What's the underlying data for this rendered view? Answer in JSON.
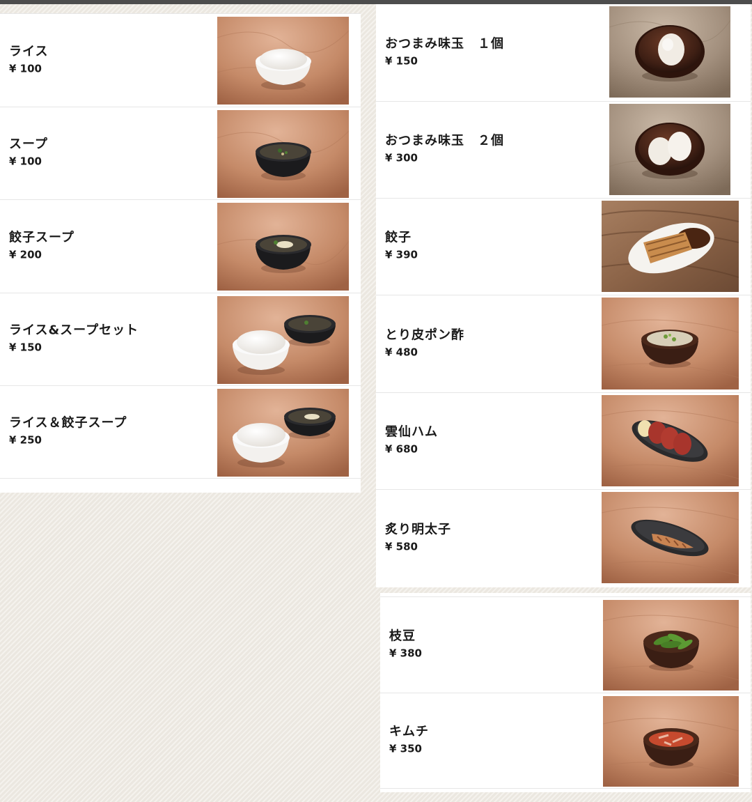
{
  "left_panel": {
    "items": [
      {
        "name": "ライス",
        "price": "¥ 100"
      },
      {
        "name": "スープ",
        "price": "¥ 100"
      },
      {
        "name": "餃子スープ",
        "price": "¥ 200"
      },
      {
        "name": "ライス&スープセット",
        "price": "¥ 150"
      },
      {
        "name": "ライス＆餃子スープ",
        "price": "¥ 250"
      }
    ]
  },
  "right_panel": {
    "items": [
      {
        "name": "おつまみ味玉　１個",
        "price": "¥ 150"
      },
      {
        "name": "おつまみ味玉　２個",
        "price": "¥ 300"
      },
      {
        "name": "餃子",
        "price": "¥ 390"
      },
      {
        "name": "とり皮ポン酢",
        "price": "¥ 480"
      },
      {
        "name": "雲仙ハム",
        "price": "¥ 680"
      },
      {
        "name": "炙り明太子",
        "price": "¥ 580"
      }
    ]
  },
  "right_panel_2": {
    "items": [
      {
        "name": "枝豆",
        "price": "¥ 380"
      },
      {
        "name": "キムチ",
        "price": "¥ 350"
      }
    ]
  },
  "colors": {
    "wood_warm": "#c58a68",
    "wood_grey": "#a28f7d",
    "background": "#efebe4",
    "top_bar": "#4d4d4d"
  }
}
